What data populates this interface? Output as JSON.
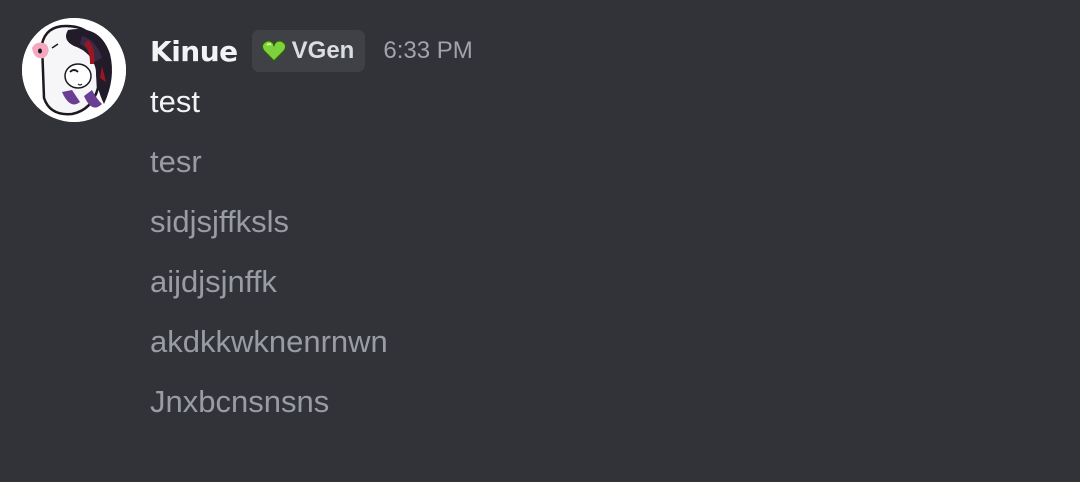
{
  "message": {
    "author": {
      "name": "Kinue",
      "avatar_icon": "avatar-icon"
    },
    "tag": {
      "icon": "green-heart-icon",
      "label": "VGen",
      "color": "#8ee34b"
    },
    "timestamp": "6:33 PM",
    "lines": [
      "test",
      "tesr",
      "sidjsjffksls",
      "aijdjsjnffk",
      "akdkkwknenrnwn",
      "Jnxbcnsnsns"
    ]
  },
  "colors": {
    "background": "#313338",
    "primary_text": "#f2f3f5",
    "secondary_text": "#9a9ca3",
    "tag_background": "#3f4147"
  }
}
